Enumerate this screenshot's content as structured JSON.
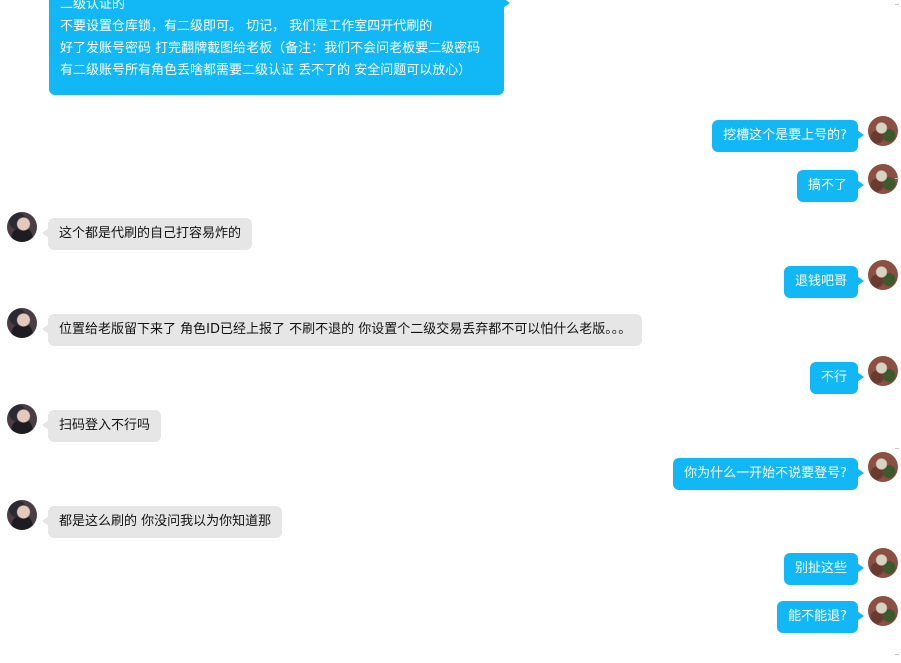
{
  "conversation": {
    "top_message": {
      "lines": [
        "二级认证的",
        "不要设置仓库锁，有二级即可。 切记，   我们是工作室四开代刷的",
        "好了发账号密码 打完翻牌截图给老板（备注：我们不会问老板要二级密码",
        "有二级账号所有角色丢啥都需要二级认证 丢不了的    安全问题可以放心）"
      ]
    },
    "messages": [
      {
        "side": "self",
        "text": "挖槽这个是要上号的?"
      },
      {
        "side": "self",
        "text": "搞不了"
      },
      {
        "side": "other",
        "text": "这个都是代刷的自己打容易炸的"
      },
      {
        "side": "self",
        "text": "退钱吧哥"
      },
      {
        "side": "other",
        "text": "位置给老版留下来了  角色ID已经上报了 不刷不退的  你设置个二级交易丢弃都不可以怕什么老版。。。"
      },
      {
        "side": "self",
        "text": "不行"
      },
      {
        "side": "other",
        "text": "扫码登入不行吗"
      },
      {
        "side": "self",
        "text": "你为什么一开始不说要登号?"
      },
      {
        "side": "other",
        "text": "都是这么刷的 你没问我以为你知道那"
      },
      {
        "side": "self",
        "text": "别扯这些"
      },
      {
        "side": "self",
        "text": "能不能退?"
      }
    ]
  },
  "colors": {
    "outgoing_bubble": "#12b7f5",
    "incoming_bubble": "#e6e6e6",
    "background": "#ffffff"
  }
}
